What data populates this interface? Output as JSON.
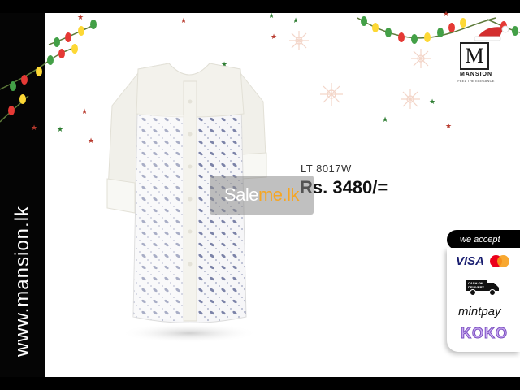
{
  "brand": {
    "website": "www.mansion.lk",
    "logo_letter": "M",
    "logo_name": "MANSION",
    "logo_tagline": "FEEL THE ELEGANCE"
  },
  "product": {
    "sku": "LT 8017W",
    "price": "Rs. 3480/="
  },
  "watermark": {
    "text_main": "Sale",
    "text_accent": "me.lk"
  },
  "payments": {
    "header": "we accept",
    "visa": "VISA",
    "cod_line1": "CASH ON",
    "cod_line2": "DELIVERY",
    "mintpay": "mintpay",
    "koko": "KOKO"
  },
  "colors": {
    "background": "#ffffff",
    "strip": "#050505",
    "light_red": "#e53935",
    "light_green": "#43a047",
    "light_yellow": "#fdd835",
    "watermark_accent": "#f6a623"
  }
}
